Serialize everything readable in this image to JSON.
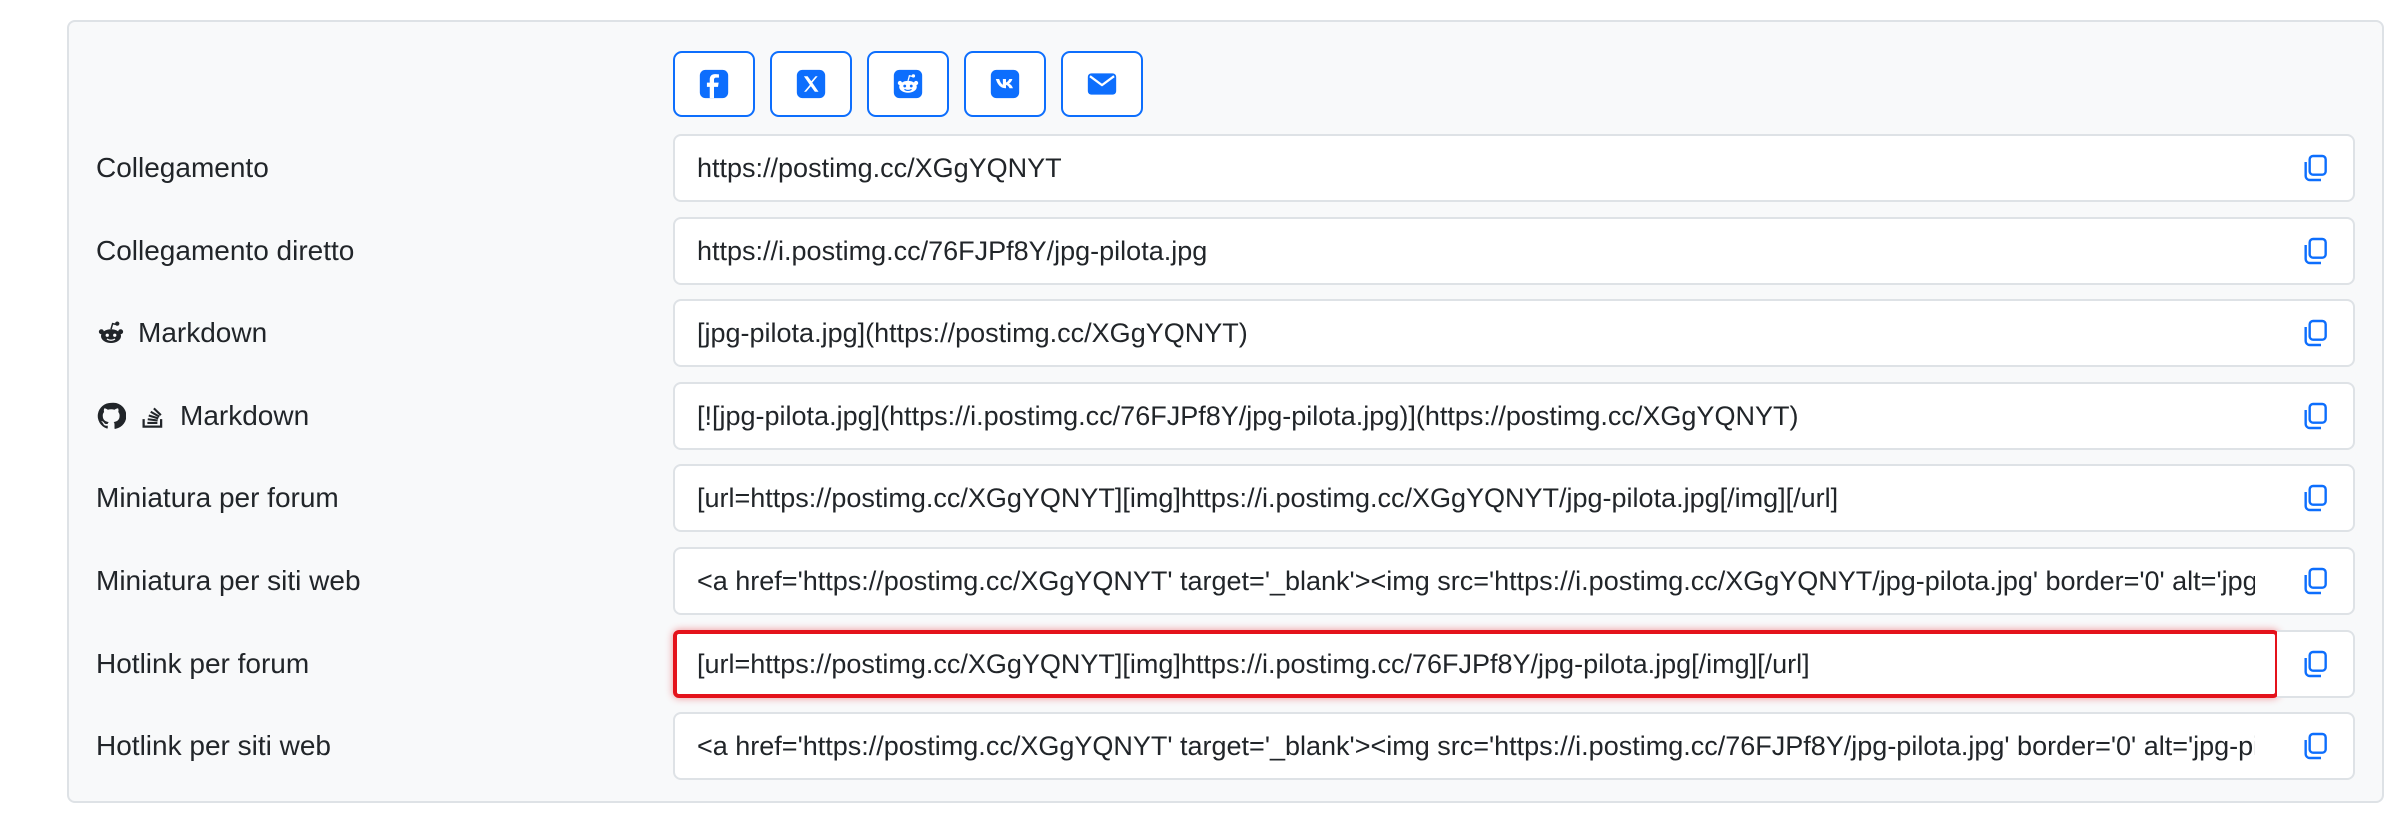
{
  "colors": {
    "accent": "#0d6efd",
    "highlight": "#e4121b",
    "panel_bg": "#f8f9fa",
    "border": "#dee2e6"
  },
  "share_buttons": [
    {
      "icon": "facebook-icon"
    },
    {
      "icon": "x-twitter-icon"
    },
    {
      "icon": "reddit-icon"
    },
    {
      "icon": "vk-icon"
    },
    {
      "icon": "envelope-icon"
    }
  ],
  "rows": [
    {
      "label": "Collegamento",
      "value": "https://postimg.cc/XGgYQNYT"
    },
    {
      "label": "Collegamento diretto",
      "value": "https://i.postimg.cc/76FJPf8Y/jpg-pilota.jpg"
    },
    {
      "label": "Markdown",
      "icons": [
        "reddit-icon"
      ],
      "value": "[jpg-pilota.jpg](https://postimg.cc/XGgYQNYT)"
    },
    {
      "label": "Markdown",
      "icons": [
        "github-icon",
        "stack-overflow-icon"
      ],
      "value": "[![jpg-pilota.jpg](https://i.postimg.cc/76FJPf8Y/jpg-pilota.jpg)](https://postimg.cc/XGgYQNYT)"
    },
    {
      "label": "Miniatura per forum",
      "value": "[url=https://postimg.cc/XGgYQNYT][img]https://i.postimg.cc/XGgYQNYT/jpg-pilota.jpg[/img][/url]"
    },
    {
      "label": "Miniatura per siti web",
      "value": "<a href='https://postimg.cc/XGgYQNYT' target='_blank'><img src='https://i.postimg.cc/XGgYQNYT/jpg-pilota.jpg' border='0' alt='jpg-pilota'/></a>"
    },
    {
      "label": "Hotlink per forum",
      "value": "[url=https://postimg.cc/XGgYQNYT][img]https://i.postimg.cc/76FJPf8Y/jpg-pilota.jpg[/img][/url]",
      "highlighted": true
    },
    {
      "label": "Hotlink per siti web",
      "value": "<a href='https://postimg.cc/XGgYQNYT' target='_blank'><img src='https://i.postimg.cc/76FJPf8Y/jpg-pilota.jpg' border='0' alt='jpg-pilota'/></a>"
    }
  ]
}
